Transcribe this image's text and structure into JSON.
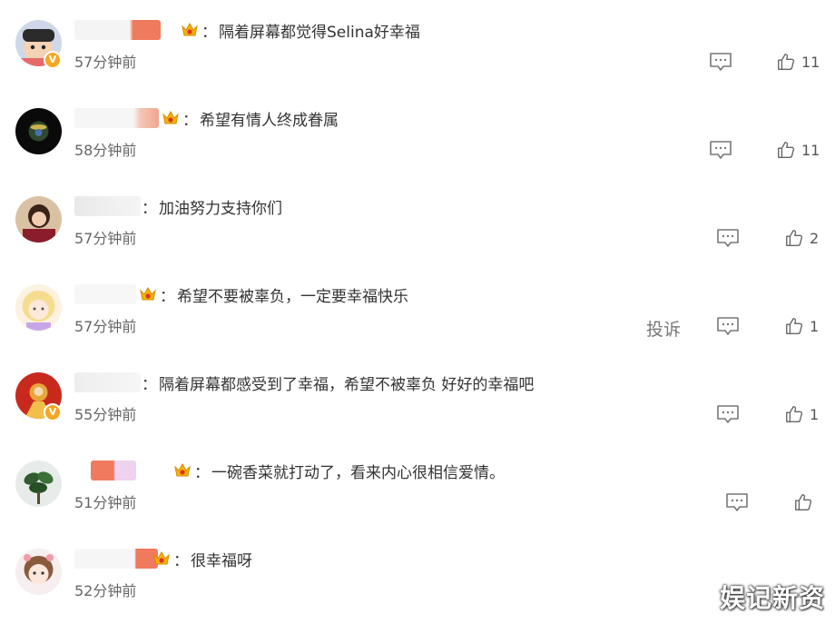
{
  "comments": [
    {
      "text": "隔着屏幕都觉得Selina好幸福",
      "time": "57分钟前",
      "likes": "11",
      "verified": true,
      "crown": true
    },
    {
      "text": "希望有情人终成眷属",
      "time": "58分钟前",
      "likes": "11",
      "verified": false,
      "crown": true
    },
    {
      "text": "加油努力支持你们",
      "time": "57分钟前",
      "likes": "2",
      "verified": false,
      "crown": false
    },
    {
      "text": "希望不要被辜负，一定要幸福快乐",
      "time": "57分钟前",
      "likes": "1",
      "verified": false,
      "crown": true,
      "report_label": "投诉"
    },
    {
      "text": "隔着屏幕都感受到了幸福，希望不被辜负 好好的幸福吧",
      "time": "55分钟前",
      "likes": "1",
      "verified": true,
      "crown": false
    },
    {
      "text": "一碗香菜就打动了，看来内心很相信爱情。",
      "time": "51分钟前",
      "likes": "",
      "verified": false,
      "crown": true
    },
    {
      "text": "很幸福呀",
      "time": "52分钟前",
      "likes": "",
      "verified": false,
      "crown": true
    }
  ],
  "separator": "：",
  "watermark": "娱记新资",
  "colors": {
    "badge": "#f5a623",
    "text": "#333333",
    "meta": "#666666"
  },
  "icons": {
    "reply": "comment-icon",
    "like": "thumbs-up-icon",
    "crown": "crown-icon",
    "verified": "verified-badge-icon"
  }
}
